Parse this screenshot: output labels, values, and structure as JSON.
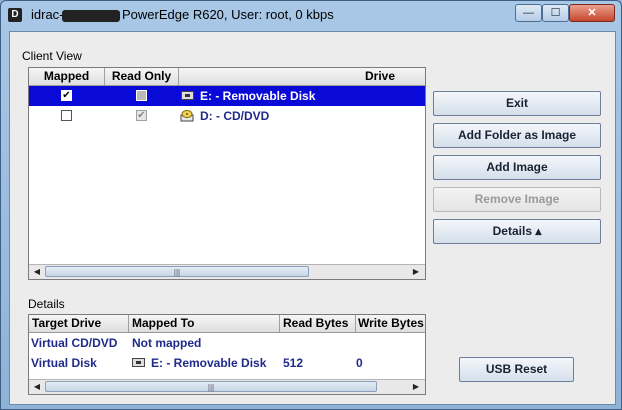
{
  "window": {
    "app_icon": "D",
    "title_prefix": "idrac-",
    "title_suffix": "PowerEdge R620, User: root, 0 kbps",
    "controls": {
      "minimize": "—",
      "maximize": "☐",
      "close": "✕"
    }
  },
  "client_view": {
    "label": "Client View",
    "columns": [
      "Mapped",
      "Read Only",
      "Drive"
    ],
    "rows": [
      {
        "mapped": "✔",
        "read_only": "",
        "drive": "E: - Removable Disk",
        "icon": "removable-disk-icon",
        "selected": true
      },
      {
        "mapped": "",
        "read_only": "✔",
        "drive": "D: - CD/DVD",
        "icon": "cd-dvd-icon",
        "selected": false
      }
    ]
  },
  "buttons": {
    "exit": "Exit",
    "add_folder": "Add Folder as Image",
    "add_image": "Add Image",
    "remove_image": "Remove Image",
    "details": "Details ▴",
    "usb_reset": "USB Reset"
  },
  "details": {
    "label": "Details",
    "columns": [
      "Target Drive",
      "Mapped To",
      "Read Bytes",
      "Write Bytes"
    ],
    "rows": [
      {
        "target": "Virtual CD/DVD",
        "mapped_to": "Not mapped",
        "read": "",
        "write": ""
      },
      {
        "target": "Virtual Disk",
        "mapped_to": "E: - Removable Disk",
        "read": "512",
        "write": "0"
      }
    ]
  },
  "scroll_glyphs": {
    "left": "◀",
    "right": "▶",
    "grip": "|||"
  },
  "colors": {
    "selection": "#0a0ad8",
    "cell_text": "#1f2a8a"
  }
}
